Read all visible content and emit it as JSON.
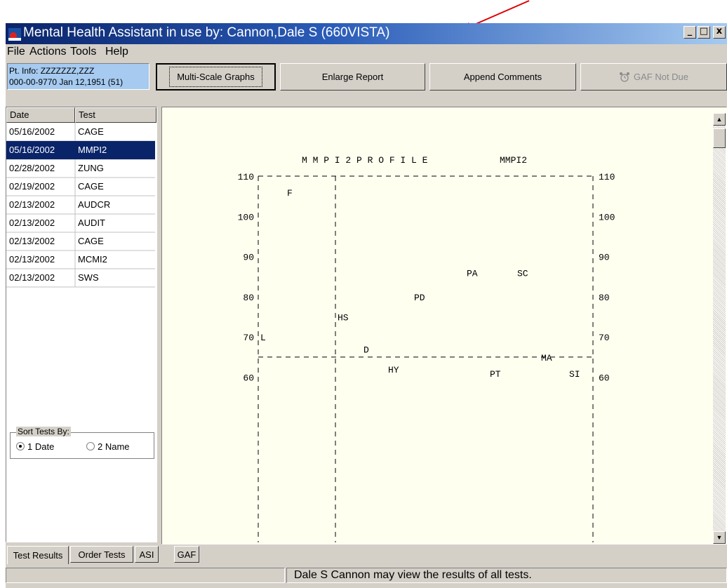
{
  "window": {
    "title": "Mental Health Assistant in use by: Cannon,Dale S  (660VISTA)",
    "min_label": "_",
    "max_label": "□",
    "close_label": "x"
  },
  "menu": [
    {
      "label": "File"
    },
    {
      "label": "Actions"
    },
    {
      "label": "Tools"
    },
    {
      "label": "Help"
    }
  ],
  "toolbar": {
    "pt_info_line1": "Pt. Info: ZZZZZZZ,ZZZ",
    "pt_info_line2": "000-00-9770  Jan 12,1951 (51)",
    "multi_scale_label": "Multi-Scale Graphs",
    "enlarge_label": "Enlarge Report",
    "append_label": "Append Comments",
    "gaf_label": "GAF Not Due"
  },
  "tests_table": {
    "headers": [
      "Date",
      "Test"
    ],
    "rows": [
      {
        "date": "05/16/2002",
        "test": "CAGE"
      },
      {
        "date": "05/16/2002",
        "test": "MMPI2"
      },
      {
        "date": "02/28/2002",
        "test": "ZUNG"
      },
      {
        "date": "02/19/2002",
        "test": "CAGE"
      },
      {
        "date": "02/13/2002",
        "test": "AUDCR"
      },
      {
        "date": "02/13/2002",
        "test": "AUDIT"
      },
      {
        "date": "02/13/2002",
        "test": "CAGE"
      },
      {
        "date": "02/13/2002",
        "test": "MCMI2"
      },
      {
        "date": "02/13/2002",
        "test": "SWS"
      }
    ],
    "selected_index": 1
  },
  "sort": {
    "legend": "Sort Tests By:",
    "option1": "1 Date",
    "option2": "2 Name",
    "selected": "1 Date"
  },
  "report": {
    "title": "M M P I 2   P R O F I L E",
    "test_code": "MMPI2",
    "y_ticks": [
      110,
      100,
      90,
      80,
      70,
      60
    ],
    "plot_rows": [
      {
        "y": 100,
        "left": "100|                       |",
        "right": "|100"
      }
    ],
    "points": [
      {
        "label": "F",
        "value": 106
      },
      {
        "label": "L",
        "value": 70
      },
      {
        "label": "HS",
        "value": 75
      },
      {
        "label": "D",
        "value": 67
      },
      {
        "label": "HY",
        "value": 62
      },
      {
        "label": "PD",
        "value": 80
      },
      {
        "label": "PA",
        "value": 86
      },
      {
        "label": "SC",
        "value": 86
      },
      {
        "label": "PT",
        "value": 61
      },
      {
        "label": "SI",
        "value": 61
      },
      {
        "label": "MA",
        "value": 65
      }
    ]
  },
  "tabs": [
    {
      "label": "Test Results"
    },
    {
      "label": "Order Tests"
    },
    {
      "label": "ASI"
    },
    {
      "label": "GAF"
    }
  ],
  "status": {
    "left": "",
    "message": "Dale S Cannon may view the results of all tests."
  },
  "colors": {
    "titlebar": "#0a246a",
    "annotation_arrow": "#e00000",
    "report_bg": "#fffff0"
  }
}
